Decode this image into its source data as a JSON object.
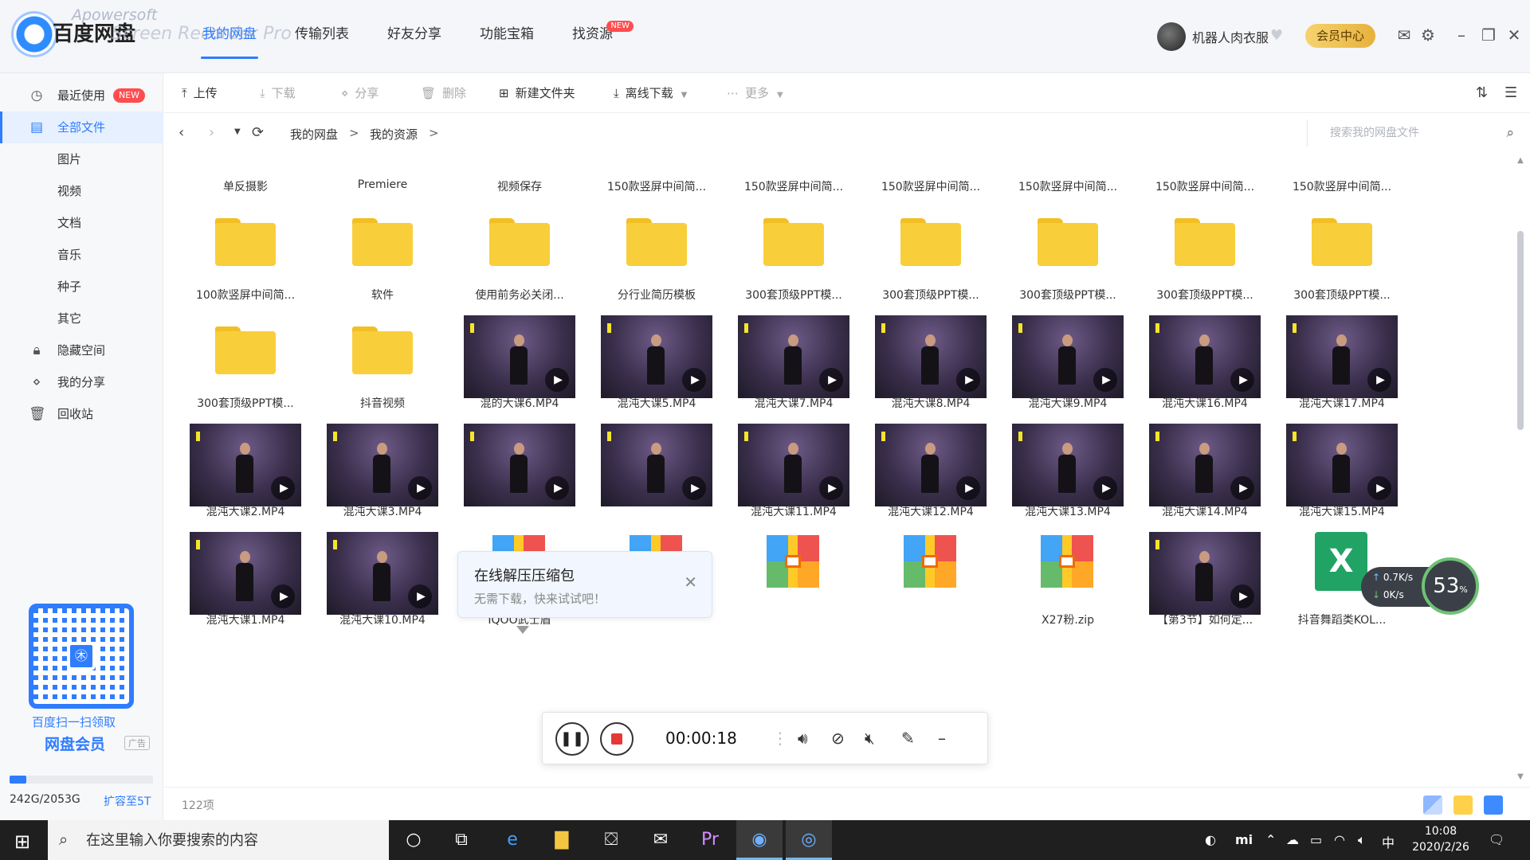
{
  "app": {
    "logo_text": "百度网盘",
    "watermark_line1": "Apowersoft",
    "watermark_line2": "Screen Recorder Pro"
  },
  "nav": {
    "items": [
      {
        "label": "我的网盘",
        "active": true
      },
      {
        "label": "传输列表"
      },
      {
        "label": "好友分享"
      },
      {
        "label": "功能宝箱"
      },
      {
        "label": "找资源",
        "badge": "NEW"
      }
    ]
  },
  "user": {
    "name": "机器人肉衣服",
    "vip_button": "会员中心"
  },
  "sidebar": {
    "items": [
      {
        "label": "最近使用",
        "icon": "clock-icon",
        "badge": "NEW"
      },
      {
        "label": "全部文件",
        "icon": "file-icon",
        "active": true
      },
      {
        "label": "图片"
      },
      {
        "label": "视频"
      },
      {
        "label": "文档"
      },
      {
        "label": "音乐"
      },
      {
        "label": "种子"
      },
      {
        "label": "其它"
      },
      {
        "label": "隐藏空间",
        "icon": "lock-icon"
      },
      {
        "label": "我的分享",
        "icon": "share-icon"
      },
      {
        "label": "回收站",
        "icon": "trash-icon"
      }
    ],
    "promo_line1": "百度扫一扫领取",
    "promo_line2": "网盘会员",
    "ad_tag": "广告",
    "storage_text": "242G/2053G",
    "storage_fraction": 0.118,
    "expand_text": "扩容至5T"
  },
  "toolbar": {
    "upload": "上传",
    "download": "下载",
    "share": "分享",
    "delete": "删除",
    "new_folder": "新建文件夹",
    "offline_download": "离线下载",
    "more": "更多"
  },
  "path": {
    "crumbs": [
      "我的网盘",
      "我的资源"
    ],
    "search_placeholder": "搜索我的网盘文件"
  },
  "files": {
    "row1": [
      "单反摄影",
      "Premiere",
      "视频保存",
      "150款竖屏中间简...",
      "150款竖屏中间简...",
      "150款竖屏中间简...",
      "150款竖屏中间简...",
      "150款竖屏中间简...",
      "150款竖屏中间简..."
    ],
    "row2": [
      "100款竖屏中间简...",
      "软件",
      "使用前务必关闭...",
      "分行业简历模板",
      "300套顶级PPT模...",
      "300套顶级PPT模...",
      "300套顶级PPT模...",
      "300套顶级PPT模...",
      "300套顶级PPT模..."
    ],
    "row3": [
      "300套顶级PPT模...",
      "抖音视频",
      "混的大课6.MP4",
      "混沌大课5.MP4",
      "混沌大课7.MP4",
      "混沌大课8.MP4",
      "混沌大课9.MP4",
      "混沌大课16.MP4",
      "混沌大课17.MP4"
    ],
    "row4": [
      "混沌大课2.MP4",
      "混沌大课3.MP4",
      "",
      "",
      "混沌大课11.MP4",
      "混沌大课12.MP4",
      "混沌大课13.MP4",
      "混沌大课14.MP4",
      "混沌大课15.MP4"
    ],
    "row5": [
      "混沌大课1.MP4",
      "混沌大课10.MP4",
      "IQOO武士盾",
      "",
      "",
      "",
      "X27粉.zip",
      "【第3节】如何定...",
      "抖音舞蹈类KOL..."
    ],
    "count": "122项"
  },
  "tooltip": {
    "title": "在线解压压缩包",
    "subtitle": "无需下载，快来试试吧！"
  },
  "recorder": {
    "time": "00:00:18"
  },
  "speed": {
    "up": "0.7K/s",
    "down": "0K/s",
    "percent": "53",
    "percent_unit": "%"
  },
  "taskbar": {
    "search_placeholder": "在这里输入你要搜索的内容",
    "ime": "中",
    "time": "10:08",
    "date": "2020/2/26"
  },
  "colors": {
    "accent": "#2f7cff",
    "folder": "#f8cf3a",
    "new_badge": "#ff4d4f"
  }
}
